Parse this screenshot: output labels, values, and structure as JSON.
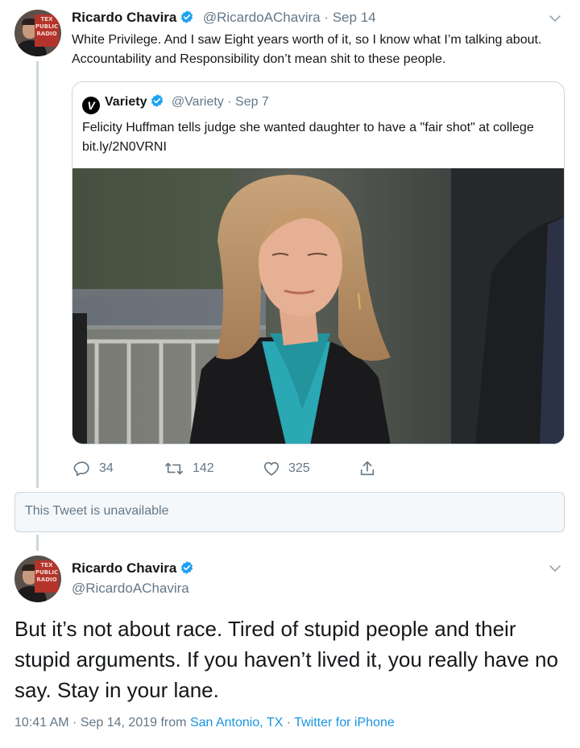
{
  "tweet1": {
    "author_name": "Ricardo Chavira",
    "handle": "@RicardoAChavira",
    "date": "Sep 14",
    "text": "White Privilege. And I saw Eight years worth of it, so I know what I’m talking about. Accountability and Responsibility don’t mean shit to these people.",
    "quote": {
      "author_name": "Variety",
      "handle": "@Variety",
      "date": "Sep 7",
      "text": "Felicity Huffman tells judge she wanted daughter to have a \"fair shot\" at college bit.ly/2N0VRNI"
    },
    "actions": {
      "replies": "34",
      "retweets": "142",
      "likes": "325"
    }
  },
  "unavailable_text": "This Tweet is unavailable",
  "tweet2": {
    "author_name": "Ricardo Chavira",
    "handle": "@RicardoAChavira",
    "text": "But it’s not about race. Tired of stupid people and their stupid arguments. If you haven’t lived it, you really have no say. Stay in your lane.",
    "time": "10:41 AM",
    "date": "Sep 14, 2019",
    "from_label": "from",
    "location": "San Antonio, TX",
    "source": "Twitter for iPhone"
  },
  "colors": {
    "accent": "#1b95e0",
    "muted": "#657786",
    "border": "#ccd6dd",
    "verified": "#1da1f2"
  }
}
